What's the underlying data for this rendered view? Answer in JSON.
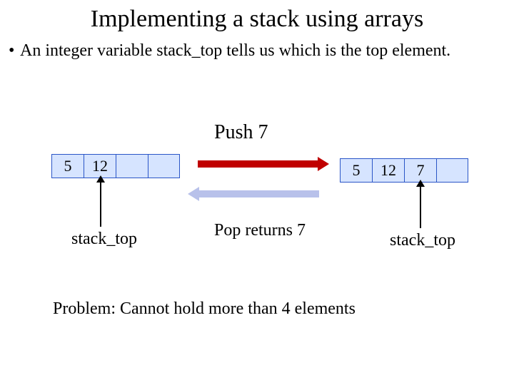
{
  "title": "Implementing a stack using arrays",
  "bullet": "An integer variable stack_top tells us which is the top element.",
  "push_label": "Push 7",
  "pop_label": "Pop returns 7",
  "array_left": [
    "5",
    "12",
    "",
    ""
  ],
  "array_right": [
    "5",
    "12",
    "7",
    ""
  ],
  "ptr_label_left": "stack_top",
  "ptr_label_right": "stack_top",
  "problem": "Problem: Cannot hold more than 4 elements"
}
